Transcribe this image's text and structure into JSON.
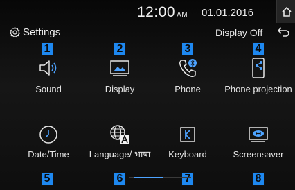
{
  "status": {
    "time": "12:00",
    "ampm": "AM",
    "date": "01.01.2016"
  },
  "header": {
    "title": "Settings",
    "display_off": "Display Off"
  },
  "tiles": [
    {
      "label": "Sound",
      "icon": "speaker-icon",
      "badge": "1"
    },
    {
      "label": "Display",
      "icon": "monitor-icon",
      "badge": "2"
    },
    {
      "label": "Phone",
      "icon": "bluetooth-phone-icon",
      "badge": "3"
    },
    {
      "label": "Phone projection",
      "icon": "phone-projection-icon",
      "badge": "4"
    },
    {
      "label": "Date/Time",
      "icon": "clock-icon",
      "badge": "5"
    },
    {
      "label": "Language/ भाषा",
      "icon": "language-globe-icon",
      "badge": "6"
    },
    {
      "label": "Keyboard",
      "icon": "keyboard-icon",
      "badge": "7"
    },
    {
      "label": "Screensaver",
      "icon": "screensaver-icon",
      "badge": "8"
    }
  ],
  "colors": {
    "badge": "#1e88f0",
    "indicator_active": "#4da3ff"
  }
}
